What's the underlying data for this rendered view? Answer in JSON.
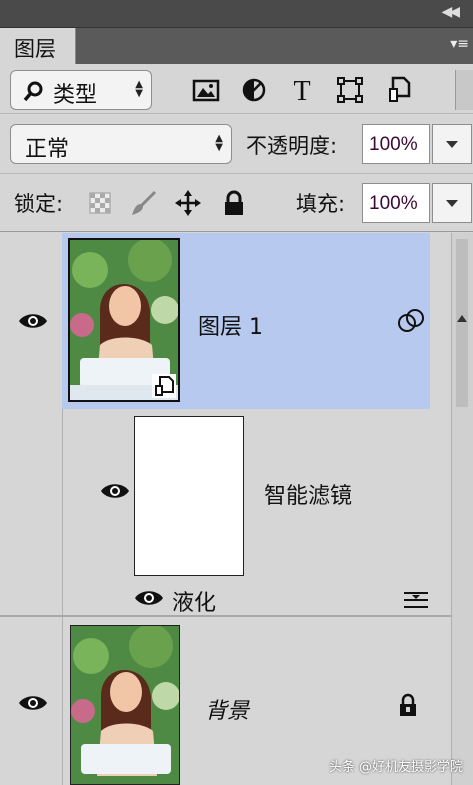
{
  "panel": {
    "tab_label": "图层"
  },
  "filter": {
    "kind_label": "类型"
  },
  "blend": {
    "mode_label": "正常",
    "opacity_label": "不透明度:",
    "opacity_value": "100%"
  },
  "lock": {
    "label": "锁定:",
    "fill_label": "填充:",
    "fill_value": "100%"
  },
  "layers": [
    {
      "name": "图层 1",
      "selected": true,
      "visible": true
    },
    {
      "smart_filters_label": "智能滤镜",
      "filter_name": "液化"
    },
    {
      "name": "背景",
      "visible": true,
      "locked": true
    }
  ],
  "colors": {
    "selected_row": "#b7c9ee",
    "panel_bg": "#d6d6d6",
    "header_bg": "#4a4a4a"
  },
  "watermark": "头条 @好机友摄影学院",
  "icons": [
    "search-icon",
    "image-filter-icon",
    "adjustment-filter-icon",
    "type-filter-icon",
    "shape-filter-icon",
    "smart-object-filter-icon",
    "lock-pixels-icon",
    "brush-icon",
    "move-icon",
    "lock-icon",
    "eye-icon",
    "link-circles-icon",
    "filter-options-icon"
  ]
}
